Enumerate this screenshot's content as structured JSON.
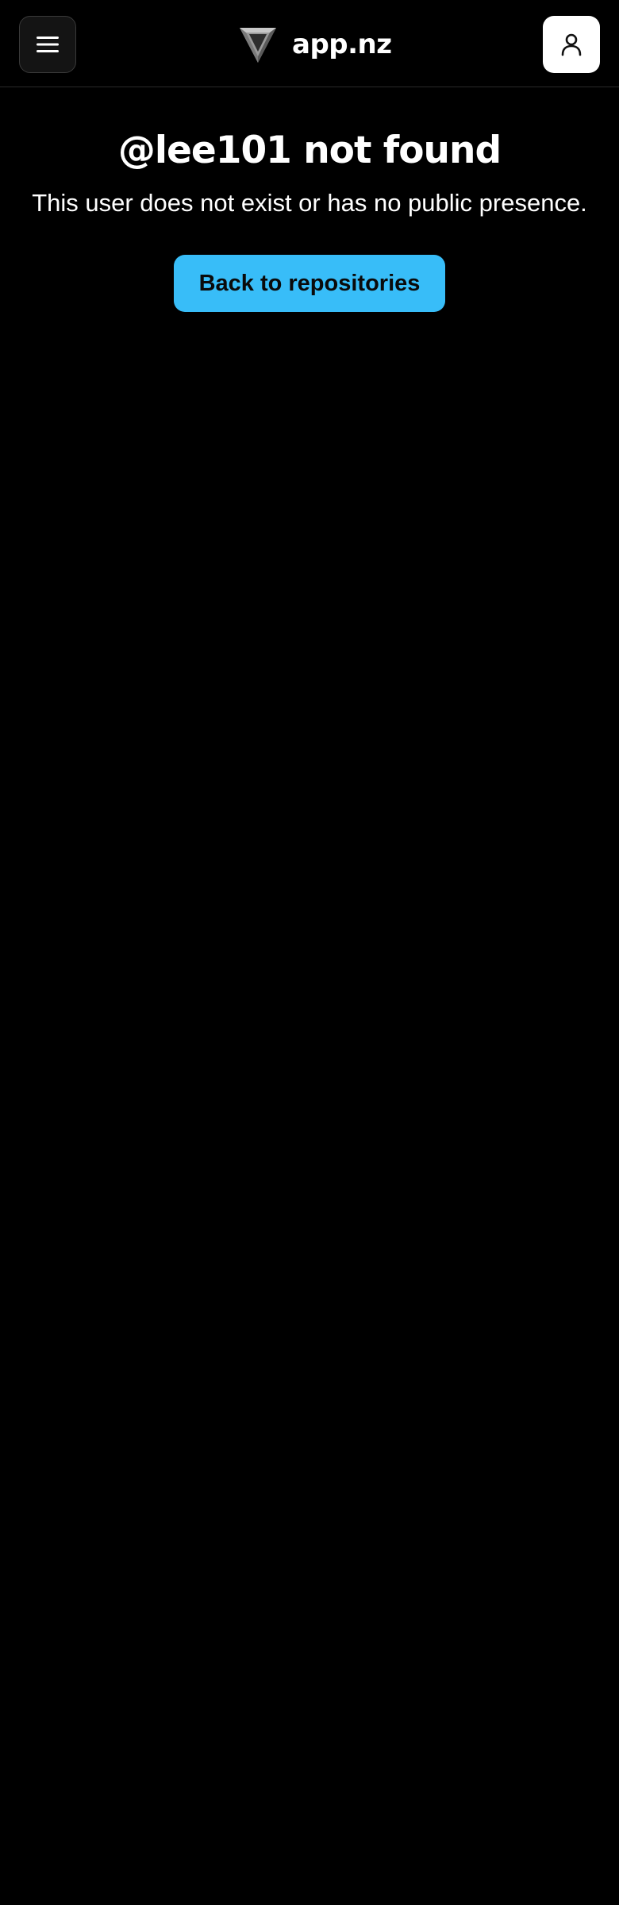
{
  "header": {
    "brand_name": "app.nz",
    "menu_icon": "hamburger-menu-icon",
    "logo_icon": "triangle-logo-icon",
    "user_icon": "user-icon"
  },
  "main": {
    "title": "@lee101 not found",
    "subtitle": "This user does not exist or has no public presence.",
    "back_button_label": "Back to repositories"
  },
  "colors": {
    "background": "#000000",
    "accent": "#38bdf8",
    "text": "#ffffff"
  }
}
